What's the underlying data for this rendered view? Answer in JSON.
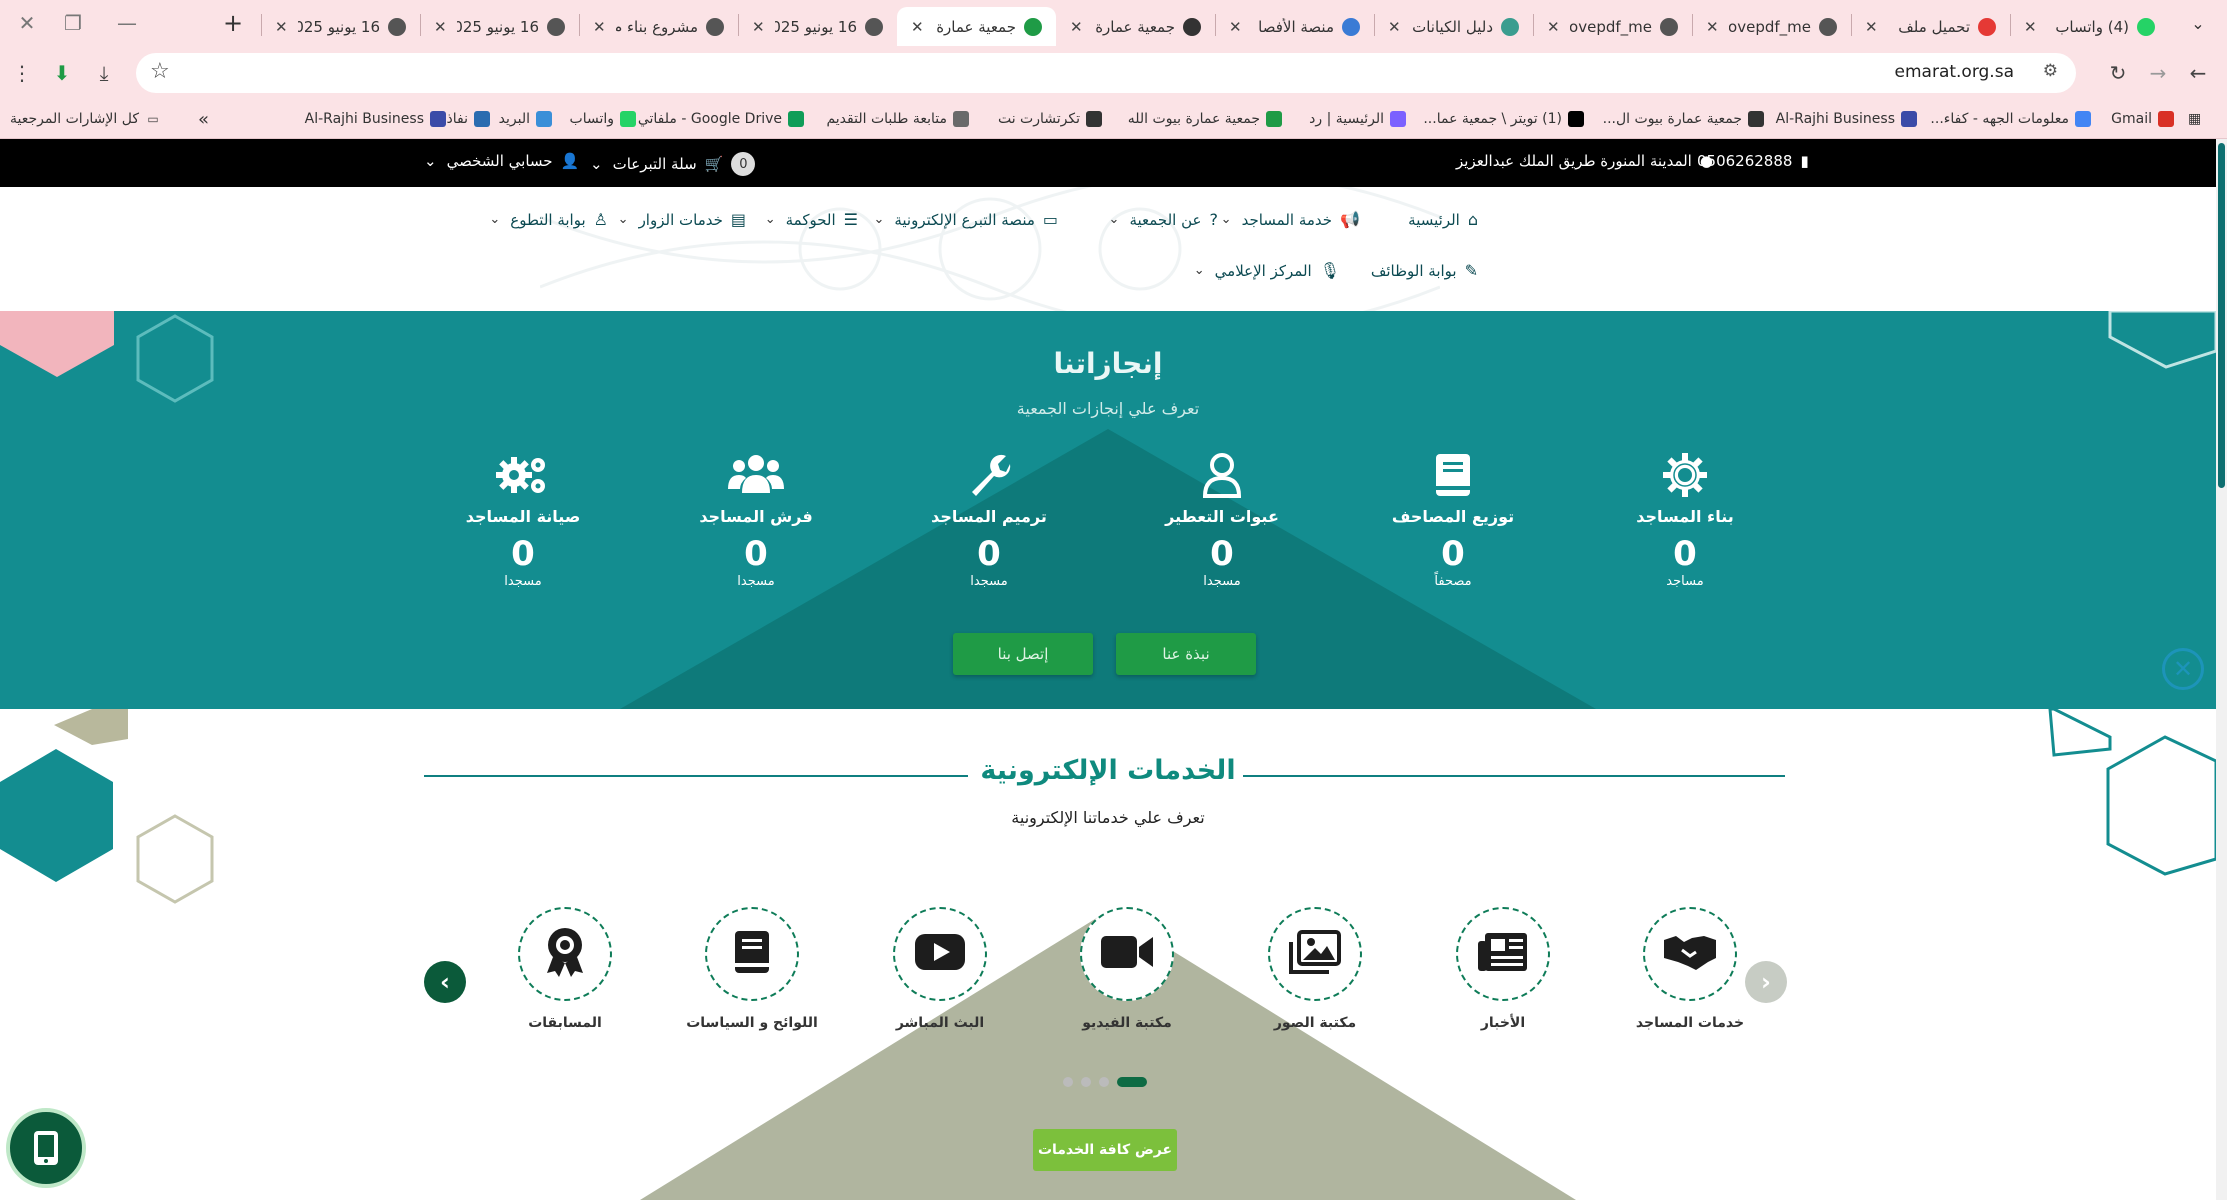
{
  "browser": {
    "tabs": [
      {
        "title": "(4) واتساب",
        "fav_color": "#25d366"
      },
      {
        "title": "تحميل ملف",
        "fav_color": "#e53935"
      },
      {
        "title": "ilovepdf_me",
        "fav_color": "#555555"
      },
      {
        "title": "ilovepdf_me",
        "fav_color": "#555555"
      },
      {
        "title": "دليل الكيانات",
        "fav_color": "#3a9d8f"
      },
      {
        "title": "منصة الأفصا",
        "fav_color": "#3a7bd5"
      },
      {
        "title": "جمعية عمارة",
        "fav_color": "#333333"
      },
      {
        "title": "جمعية عمارة",
        "fav_color": "#1f9b46",
        "active": true
      },
      {
        "title": "16 يونيو 025",
        "fav_color": "#555555"
      },
      {
        "title": "مشروع بناء م",
        "fav_color": "#555555"
      },
      {
        "title": "16 يونيو 025",
        "fav_color": "#555555"
      },
      {
        "title": "16 يونيو 025",
        "fav_color": "#555555"
      }
    ],
    "url": "emarat.org.sa",
    "bookmarks": [
      {
        "label": "Gmail",
        "color": "#d93025"
      },
      {
        "label": "معلومات الجهه - كفاء...",
        "color": "#4285f4"
      },
      {
        "label": "Al-Rajhi Business",
        "color": "#3b4ba8"
      },
      {
        "label": "جمعية عمارة بيوت ال...",
        "color": "#333333"
      },
      {
        "label": "(1) تويتر \\ جمعية عما...",
        "color": "#000000"
      },
      {
        "label": "الرئيسية | رد",
        "color": "#7b61ff"
      },
      {
        "label": "جمعية عمارة بيوت الله",
        "color": "#1f9b46"
      },
      {
        "label": "تكرتشارت نت",
        "color": "#333333"
      },
      {
        "label": "متابعة طلبات التقديم",
        "color": "#6a6a6a"
      },
      {
        "label": "Google Drive - ملفاتي",
        "color": "#0f9d58"
      },
      {
        "label": "واتساب",
        "color": "#25d366"
      },
      {
        "label": "البريد",
        "color": "#3a8fd8"
      },
      {
        "label": "نفاذ",
        "color": "#2b6cb0"
      },
      {
        "label": "Al-Rajhi Business",
        "color": "#3b4ba8"
      }
    ],
    "bookmarks_all": "كل الإشارات المرجعية",
    "bookmarks_more": "»"
  },
  "topbar": {
    "phone": "0506262888",
    "address": "المدينة المنورة طريق الملك عبدالعزيز",
    "cart_label": "سلة التبرعات",
    "cart_count": "0",
    "account_label": "حسابي الشخصي"
  },
  "nav": {
    "items": [
      {
        "label": "الرئيسية",
        "icon": "home-icon",
        "dropdown": false
      },
      {
        "label": "خدمة المساجد",
        "icon": "megaphone-icon",
        "dropdown": true
      },
      {
        "label": "عن الجمعية",
        "icon": "question-icon",
        "dropdown": true
      },
      {
        "label": "منصة التبرع الإلكترونية",
        "icon": "card-icon",
        "dropdown": true
      },
      {
        "label": "الحوكمة",
        "icon": "list-icon",
        "dropdown": true
      },
      {
        "label": "خدمات الزوار",
        "icon": "server-icon",
        "dropdown": true
      },
      {
        "label": "بوابة التطوع",
        "icon": "person-icon",
        "dropdown": true
      }
    ],
    "row2": [
      {
        "label": "بوابة الوظائف",
        "icon": "edit-icon",
        "dropdown": false
      },
      {
        "label": "المركز الإعلامي",
        "icon": "mic-icon",
        "dropdown": true
      }
    ]
  },
  "achievements": {
    "title": "إنجازاتنا",
    "subtitle": "تعرف علي إنجازات الجمعية",
    "stats": [
      {
        "label": "بناء المساجد",
        "value": "0",
        "unit": "مساجد",
        "icon": "gear-icon"
      },
      {
        "label": "توزيع المصاحف",
        "value": "0",
        "unit": "مصحفاً",
        "icon": "book-icon"
      },
      {
        "label": "عبوات التعطير",
        "value": "0",
        "unit": "مسجدا",
        "icon": "user-icon"
      },
      {
        "label": "ترميم المساجد",
        "value": "0",
        "unit": "مسجدا",
        "icon": "wrench-icon"
      },
      {
        "label": "فرش المساجد",
        "value": "0",
        "unit": "مسجدا",
        "icon": "users-icon"
      },
      {
        "label": "صيانة المساجد",
        "value": "0",
        "unit": "مسجدا",
        "icon": "cogs-icon"
      }
    ],
    "about_button": "نبذة عنا",
    "contact_button": "إتصل بنا",
    "colors": {
      "band": "#138d90",
      "button": "#1f9b46"
    }
  },
  "services": {
    "title": "الخدمات الإلكترونية",
    "subtitle": "تعرف علي خدماتنا الإلكترونية",
    "items": [
      {
        "label": "خدمات المساجد",
        "icon": "handshake-icon"
      },
      {
        "label": "الأخبار",
        "icon": "newspaper-icon"
      },
      {
        "label": "مكتبة الصور",
        "icon": "images-icon"
      },
      {
        "label": "مكتبة الفيديو",
        "icon": "video-icon"
      },
      {
        "label": "البث المباشر",
        "icon": "youtube-icon"
      },
      {
        "label": "اللوائح و السياسات",
        "icon": "book-icon"
      },
      {
        "label": "المسابقات",
        "icon": "award-icon"
      }
    ],
    "all_button": "عرض كافة الخدمات",
    "colors": {
      "title": "#0f8a7e",
      "button": "#7cc03c"
    }
  }
}
